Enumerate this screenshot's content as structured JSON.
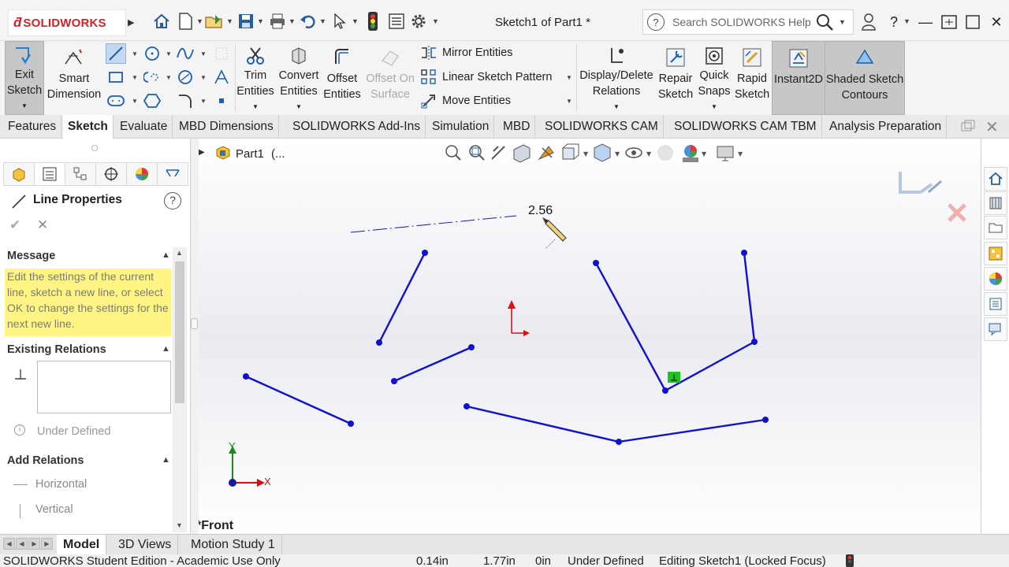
{
  "app": {
    "brand": "SOLIDWORKS",
    "document_title": "Sketch1 of Part1 *",
    "search_placeholder": "Search SOLIDWORKS Help"
  },
  "commands": {
    "exit_sketch": [
      "Exit",
      "Sketch"
    ],
    "smart_dimension": [
      "Smart",
      "Dimension"
    ],
    "trim_entities": [
      "Trim",
      "Entities"
    ],
    "convert_entities": [
      "Convert",
      "Entities"
    ],
    "offset_entities": [
      "Offset",
      "Entities"
    ],
    "offset_on_surface": [
      "Offset On",
      "Surface"
    ],
    "mirror_entities": "Mirror Entities",
    "linear_sketch_pattern": "Linear Sketch Pattern",
    "move_entities": "Move Entities",
    "display_delete_relations": [
      "Display/Delete",
      "Relations"
    ],
    "repair_sketch": [
      "Repair",
      "Sketch"
    ],
    "quick_snaps": [
      "Quick",
      "Snaps"
    ],
    "rapid_sketch": [
      "Rapid",
      "Sketch"
    ],
    "instant2d": "Instant2D",
    "shaded_sketch_contours": [
      "Shaded Sketch",
      "Contours"
    ]
  },
  "tabs": [
    "Features",
    "Sketch",
    "Evaluate",
    "MBD Dimensions",
    "SOLIDWORKS Add-Ins",
    "Simulation",
    "MBD",
    "SOLIDWORKS CAM",
    "SOLIDWORKS CAM TBM",
    "Analysis Preparation"
  ],
  "active_tab": "Sketch",
  "property_manager": {
    "title": "Line Properties",
    "message_header": "Message",
    "message_text": "Edit the settings of the current line, sketch a new line, or select OK to change the settings for the next new line.",
    "existing_relations_header": "Existing Relations",
    "status": "Under Defined",
    "add_relations_header": "Add Relations",
    "relations": [
      "Horizontal",
      "Vertical"
    ]
  },
  "graphics": {
    "tree_root": "Part1",
    "tree_extra": "(...",
    "view_name": "*Front",
    "dimension_value": "2.56",
    "axis_y": "Y",
    "axis_x": "X"
  },
  "bottom_tabs": [
    "Model",
    "3D Views",
    "Motion Study 1"
  ],
  "active_bottom_tab": "Model",
  "status_bar": {
    "edition": "SOLIDWORKS Student Edition - Academic Use Only",
    "x": "0.14in",
    "y": "1.77in",
    "z": "0in",
    "definition": "Under Defined",
    "editing": "Editing Sketch1 (Locked Focus)"
  },
  "colors": {
    "sketch_line": "#1010d0",
    "brand_red": "#d41f26",
    "message_bg": "#fff585"
  }
}
